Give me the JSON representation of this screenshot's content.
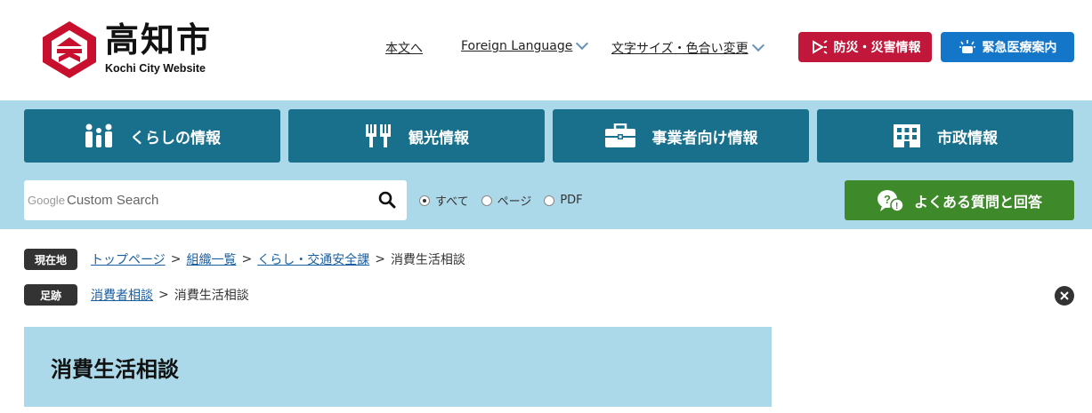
{
  "header": {
    "logo_title": "高知市",
    "logo_subtitle": "Kochi City Website",
    "links": {
      "main_text": "本文へ",
      "foreign_language": "Foreign Language",
      "text_size_color": "文字サイズ・色合い変更"
    },
    "disaster_button": "防災・災害情報",
    "medical_button": "緊急医療案内",
    "colors": {
      "disaster": "#c0173a",
      "medical": "#1476c9"
    }
  },
  "nav": {
    "items": [
      {
        "label": "くらしの情報",
        "icon": "family-icon"
      },
      {
        "label": "観光情報",
        "icon": "tourism-icon"
      },
      {
        "label": "事業者向け情報",
        "icon": "briefcase-icon"
      },
      {
        "label": "市政情報",
        "icon": "building-icon"
      }
    ],
    "color": "#19708c"
  },
  "search": {
    "brand": "Google",
    "placeholder": "Custom Search",
    "options": [
      "すべて",
      "ページ",
      "PDF"
    ],
    "selected": "すべて"
  },
  "faq_button": "よくある質問と回答",
  "breadcrumb": {
    "current_tag": "現在地",
    "current": [
      "トップページ",
      "組織一覧",
      "くらし・交通安全課",
      "消費生活相談"
    ],
    "trail_tag": "足跡",
    "trail": [
      "消費者相談",
      "消費生活相談"
    ],
    "separator": ">"
  },
  "page": {
    "title": "消費生活相談"
  }
}
